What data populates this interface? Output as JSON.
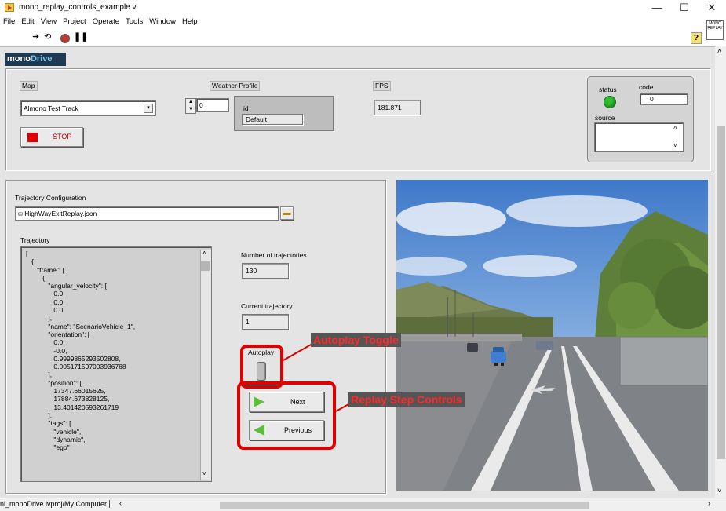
{
  "window": {
    "title": "mono_replay_controls_example.vi",
    "minimize": "—",
    "maximize": "☐",
    "close": "✕"
  },
  "menu": [
    "File",
    "Edit",
    "View",
    "Project",
    "Operate",
    "Tools",
    "Window",
    "Help"
  ],
  "toolbar": {
    "help": "?",
    "vi_icon_text": "MONO REPLAY"
  },
  "logo": {
    "part1": "mono",
    "part2": "Drive"
  },
  "map": {
    "label": "Map",
    "value": "Almono Test Track"
  },
  "stop_button": {
    "label": "STOP"
  },
  "weather": {
    "label": "Weather Profile",
    "index": "0",
    "cluster_label": "id",
    "value": "Default"
  },
  "fps": {
    "label": "FPS",
    "value": "181.871"
  },
  "error_cluster": {
    "status_label": "status",
    "code_label": "code",
    "code_value": "0",
    "source_label": "source"
  },
  "trajectory_config": {
    "label": "Trajectory Configuration",
    "path": "HighWayExitReplay.json"
  },
  "trajectory": {
    "label": "Trajectory",
    "lines": [
      "[",
      "   {",
      "      \"frame\": [",
      "         {",
      "            \"angular_velocity\": [",
      "               0.0,",
      "               0.0,",
      "               0.0",
      "            ],",
      "            \"name\": \"ScenarioVehicle_1\",",
      "            \"orientation\": [",
      "               0.0,",
      "               -0.0,",
      "               0.9999865293502808,",
      "               0.005171597003936768",
      "            ],",
      "            \"position\": [",
      "               17347.66015625,",
      "               17884.673828125,",
      "               13.401420593261719",
      "            ],",
      "            \"tags\": [",
      "               \"vehicle\",",
      "               \"dynamic\",",
      "               \"ego\""
    ]
  },
  "num_trajectories": {
    "label": "Number of trajectories",
    "value": "130"
  },
  "current_trajectory": {
    "label": "Current trajectory",
    "value": "1"
  },
  "autoplay": {
    "label": "Autoplay"
  },
  "next_button": {
    "label": "Next"
  },
  "previous_button": {
    "label": "Previous"
  },
  "annotations": {
    "autoplay": "Autoplay Toggle",
    "replay": "Replay Step Controls"
  },
  "statusbar": {
    "project": "ni_monoDrive.lvproj/My Computer"
  },
  "colors": {
    "annotation": "#e00000",
    "led": "#2fbf2f",
    "logo_bg": "#1f3a52"
  }
}
